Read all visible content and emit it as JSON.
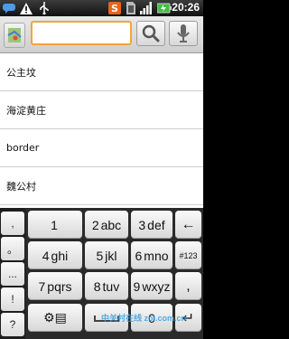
{
  "status_bar": {
    "time": "20:26",
    "icons": [
      "chat-icon",
      "warning-icon",
      "usb-icon",
      "app-icon",
      "sim-icon",
      "signal-icon",
      "battery-icon"
    ]
  },
  "search": {
    "value": "",
    "placeholder": ""
  },
  "suggestions": [
    "公主坟",
    "海淀黄庄",
    "border",
    "魏公村"
  ],
  "keyboard": {
    "candidates": [
      ",",
      "。",
      "...",
      "!",
      "?"
    ],
    "rows": [
      [
        {
          "num": "1",
          "letters": ""
        },
        {
          "num": "2",
          "letters": "abc"
        },
        {
          "num": "3",
          "letters": "def"
        }
      ],
      [
        {
          "num": "4",
          "letters": "ghi"
        },
        {
          "num": "5",
          "letters": "jkl"
        },
        {
          "num": "6",
          "letters": "mno"
        }
      ],
      [
        {
          "num": "7",
          "letters": "pqrs"
        },
        {
          "num": "8",
          "letters": "tuv"
        },
        {
          "num": "9",
          "letters": "wxyz"
        }
      ]
    ],
    "backspace": "←",
    "sym_key": "#123",
    "comma_key": ",",
    "settings_key": "⚙▤",
    "space_key": "",
    "zero_key": "0",
    "enter_key": "↵"
  },
  "watermark": "中关村在线 zol.com.cn"
}
